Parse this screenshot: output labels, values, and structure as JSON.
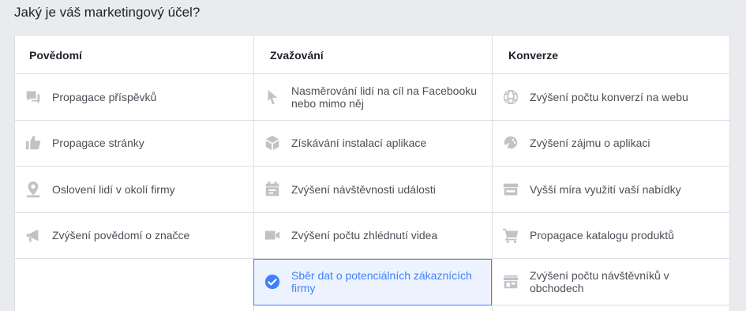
{
  "question": "Jaký je váš marketingový účel?",
  "columns": [
    {
      "heading": "Povědomí",
      "items": [
        {
          "label": "Propagace příspěvků",
          "icon": "post-boost-icon"
        },
        {
          "label": "Propagace stránky",
          "icon": "thumbs-up-icon"
        },
        {
          "label": "Oslovení lidí v okolí firmy",
          "icon": "location-pin-icon"
        },
        {
          "label": "Zvýšení povědomí o značce",
          "icon": "megaphone-icon"
        }
      ]
    },
    {
      "heading": "Zvažování",
      "items": [
        {
          "label": "Nasměrování lidí na cíl na Facebooku nebo mimo něj",
          "icon": "cursor-icon"
        },
        {
          "label": "Získávání instalací aplikace",
          "icon": "app-box-icon"
        },
        {
          "label": "Zvýšení návštěvnosti události",
          "icon": "calendar-icon"
        },
        {
          "label": "Zvýšení počtu zhlédnutí videa",
          "icon": "video-camera-icon"
        },
        {
          "label": "Sběr dat o potenciálních zákaznících firmy",
          "icon": "check-circle-icon",
          "selected": true
        }
      ]
    },
    {
      "heading": "Konverze",
      "items": [
        {
          "label": "Zvýšení počtu konverzí na webu",
          "icon": "globe-icon"
        },
        {
          "label": "Zvýšení zájmu o aplikaci",
          "icon": "gamepad-icon"
        },
        {
          "label": "Vyšší míra využití vaší nabídky",
          "icon": "offer-icon"
        },
        {
          "label": "Propagace katalogu produktů",
          "icon": "shopping-cart-icon"
        },
        {
          "label": "Zvýšení počtu návštěvníků v obchodech",
          "icon": "store-icon"
        }
      ]
    }
  ],
  "colors": {
    "accent": "#4080ff",
    "selected_bg": "#ecf3ff",
    "icon_gray": "#bec3c9"
  }
}
